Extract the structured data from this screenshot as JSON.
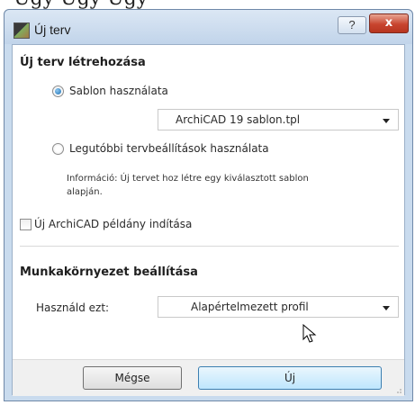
{
  "cropped_header_text": "Úgy Úgy Úgy",
  "window": {
    "title": "Új terv",
    "app_icon": "archicad-icon",
    "help_button": "?",
    "close_button": "x"
  },
  "section_new_plan": {
    "title": "Új terv létrehozása",
    "radio_template": {
      "label": "Sablon használata",
      "checked": true
    },
    "template_dropdown": {
      "value": "ArchiCAD 19 sablon.tpl"
    },
    "radio_recent": {
      "label": "Legutóbbi tervbeállítások használata",
      "checked": false
    },
    "info_text": "Információ: Új tervet hoz létre egy kiválasztott sablon alapján.",
    "new_instance_checkbox": {
      "label": "Új ArchiCAD példány indítása",
      "checked": false
    }
  },
  "section_workspace": {
    "title": "Munkakörnyezet beállítása",
    "use_label": "Használd ezt:",
    "profile_dropdown": {
      "value": "Alapértelmezett profil"
    }
  },
  "buttons": {
    "cancel": "Mégse",
    "new": "Új"
  },
  "colors": {
    "title_bar": "#c9dbee",
    "close_button": "#c8452f",
    "primary_button": "#bee6fd",
    "radio_selected": "#1c6fb3"
  }
}
